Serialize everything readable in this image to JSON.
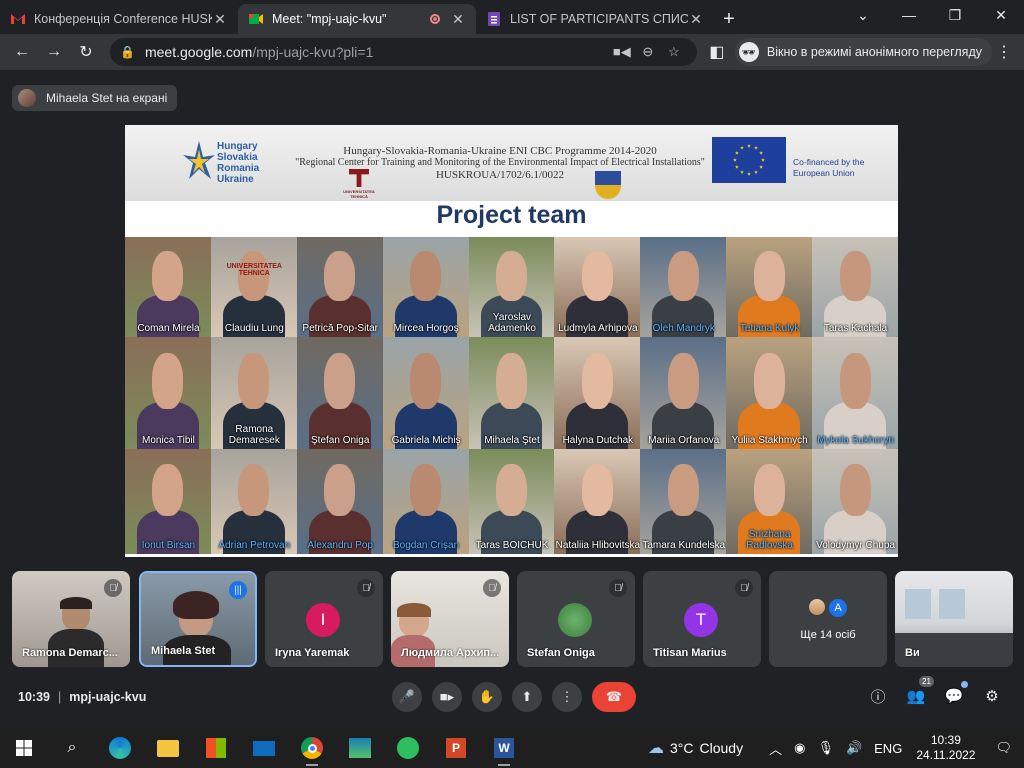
{
  "browser": {
    "tabs": [
      {
        "title": "Конференція Conference HUSKR",
        "active": false,
        "icon": "gmail-icon"
      },
      {
        "title": "Meet: \"mpj-uajc-kvu\"",
        "active": true,
        "icon": "meet-icon"
      },
      {
        "title": "LIST OF PARTICIPANTS СПИСОК",
        "active": false,
        "icon": "forms-icon"
      }
    ],
    "url_host": "meet.google.com",
    "url_path": "/mpj-uajc-kvu?pli=1",
    "incognito_label": "Вікно в режимі анонімного перегляду"
  },
  "meet": {
    "presenter_label": "Mihaela Stet на екрані",
    "time": "10:39",
    "meeting_code": "mpj-uajc-kvu",
    "participant_count": "21",
    "more_label": "Ще 14 осіб",
    "tiles": [
      {
        "name": "Ramona Demarc...",
        "muted": true
      },
      {
        "name": "Mihaela Stet",
        "muted": false
      },
      {
        "name": "Iryna Yaremak",
        "muted": true,
        "initial": "I",
        "color": "#d81b60"
      },
      {
        "name": "Людмила Архип...",
        "muted": true
      },
      {
        "name": "Stefan Oniga",
        "muted": true
      },
      {
        "name": "Titisan Marius",
        "muted": true,
        "initial": "T",
        "color": "#9334e6"
      },
      {
        "name": "Ще 14 осіб"
      },
      {
        "name": "Ви"
      }
    ],
    "more_avatar_initial": "A"
  },
  "slide": {
    "logo_words": [
      "Hungary",
      "Slovakia",
      "Romania",
      "Ukraine"
    ],
    "programme_line1": "Hungary-Slovakia-Romania-Ukraine ENI CBC Programme 2014-2020",
    "programme_line2": "\"Regional Center for Training and Monitoring of the Environmental Impact of Electrical Installations\"",
    "programme_line3": "HUSKROUA/1702/6.1/0022",
    "university_label": "UNIVERSITATEA TEHNICĂ",
    "cofinanced_line1": "Co-financed by the",
    "cofinanced_line2": "European Union",
    "title": "Project team",
    "team": [
      [
        {
          "name": "Coman Mirela"
        },
        {
          "name": "Claudiu Lung",
          "banner": "UNIVERSITATEA TEHNICA"
        },
        {
          "name": "Petrică Pop-Sitar"
        },
        {
          "name": "Mircea Horgoş"
        },
        {
          "name": "Yaroslav Adamenko"
        },
        {
          "name": "Ludmyla Arhipova"
        },
        {
          "name": "Oleh Mandryk",
          "blue": true
        },
        {
          "name": "Tetiana Kulyk",
          "blue": true
        },
        {
          "name": "Taras Kachala"
        }
      ],
      [
        {
          "name": "Monica Tibil"
        },
        {
          "name": "Ramona Demaresek"
        },
        {
          "name": "Ştefan Oniga"
        },
        {
          "name": "Gabriela Michiş"
        },
        {
          "name": "Mihaela Ştet"
        },
        {
          "name": "Halyna Dutchak"
        },
        {
          "name": "Mariia Orfanova"
        },
        {
          "name": "Yuliia Stakhmych"
        },
        {
          "name": "Mykola Sukhoryn",
          "blue": true
        }
      ],
      [
        {
          "name": "Ionut Birsan",
          "blue": true
        },
        {
          "name": "Adrian Petrovan",
          "blue": true
        },
        {
          "name": "Alexandru Pop",
          "blue": true
        },
        {
          "name": "Bogdan Crişan",
          "blue": true
        },
        {
          "name": "Taras BOICHUK"
        },
        {
          "name": "Nataliia Hlibovitska"
        },
        {
          "name": "Tamara Kundelska"
        },
        {
          "name": "Snizhana Radlovska",
          "blue": true
        },
        {
          "name": "Volodymyr Chupa"
        }
      ]
    ]
  },
  "taskbar": {
    "weather_temp": "3°C",
    "weather_text": "Cloudy",
    "lang": "ENG",
    "clock_time": "10:39",
    "clock_date": "24.11.2022"
  }
}
